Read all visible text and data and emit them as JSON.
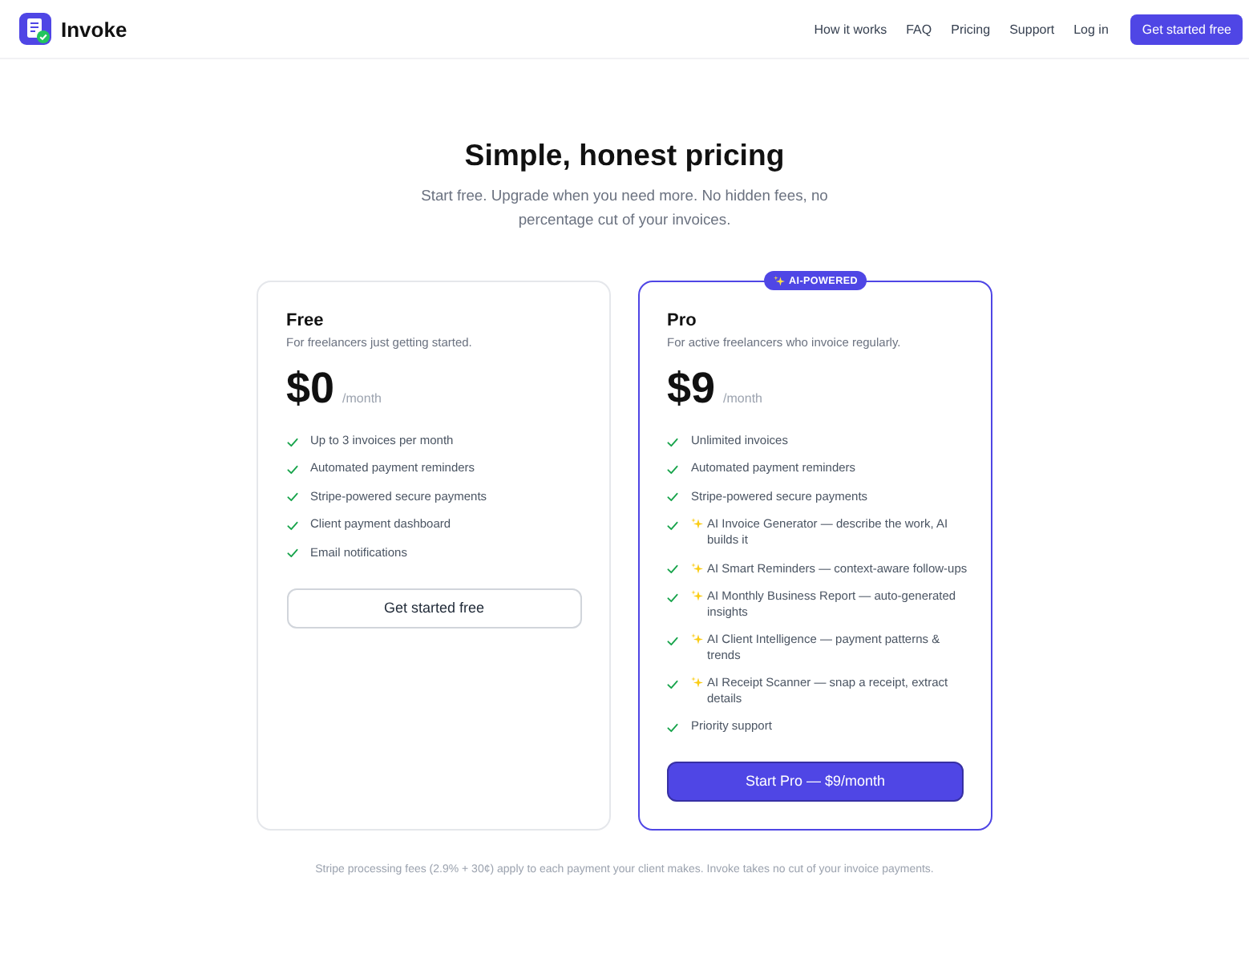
{
  "header": {
    "brand": "Invoke",
    "nav": [
      {
        "label": "How it works"
      },
      {
        "label": "FAQ"
      },
      {
        "label": "Pricing"
      },
      {
        "label": "Support"
      },
      {
        "label": "Log in"
      }
    ],
    "cta": "Get started free"
  },
  "hero": {
    "title": "Simple, honest pricing",
    "subtitle": "Start free. Upgrade when you need more. No hidden fees, no percentage cut of your invoices."
  },
  "plans": [
    {
      "kind": "standard",
      "name": "Free",
      "description": "For freelancers just getting started.",
      "price": "$0",
      "period": "/month",
      "features": [
        {
          "kind": "plain",
          "text": "Up to 3 invoices per month"
        },
        {
          "kind": "plain",
          "text": "Automated payment reminders"
        },
        {
          "kind": "plain",
          "text": "Stripe-powered secure payments"
        },
        {
          "kind": "plain",
          "text": "Client payment dashboard"
        },
        {
          "kind": "plain",
          "text": "Email notifications"
        }
      ],
      "button": "Get started free"
    },
    {
      "kind": "featured",
      "badge": "AI-POWERED",
      "name": "Pro",
      "description": "For active freelancers who invoice regularly.",
      "price": "$9",
      "period": "/month",
      "features": [
        {
          "kind": "plain",
          "text": "Unlimited invoices"
        },
        {
          "kind": "plain",
          "text": "Automated payment reminders"
        },
        {
          "kind": "plain",
          "text": "Stripe-powered secure payments"
        },
        {
          "kind": "ai",
          "text": "AI Invoice Generator — describe the work, AI builds it"
        },
        {
          "kind": "ai",
          "text": "AI Smart Reminders — context-aware follow-ups"
        },
        {
          "kind": "ai",
          "text": "AI Monthly Business Report — auto-generated insights"
        },
        {
          "kind": "ai",
          "text": "AI Client Intelligence — payment patterns & trends"
        },
        {
          "kind": "ai",
          "text": "AI Receipt Scanner — snap a receipt, extract details"
        },
        {
          "kind": "plain",
          "text": "Priority support"
        }
      ],
      "button": "Start Pro — $9/month"
    }
  ],
  "footnote": "Stripe processing fees (2.9% + 30¢) apply to each payment your client makes. Invoke takes no cut of your invoice payments."
}
